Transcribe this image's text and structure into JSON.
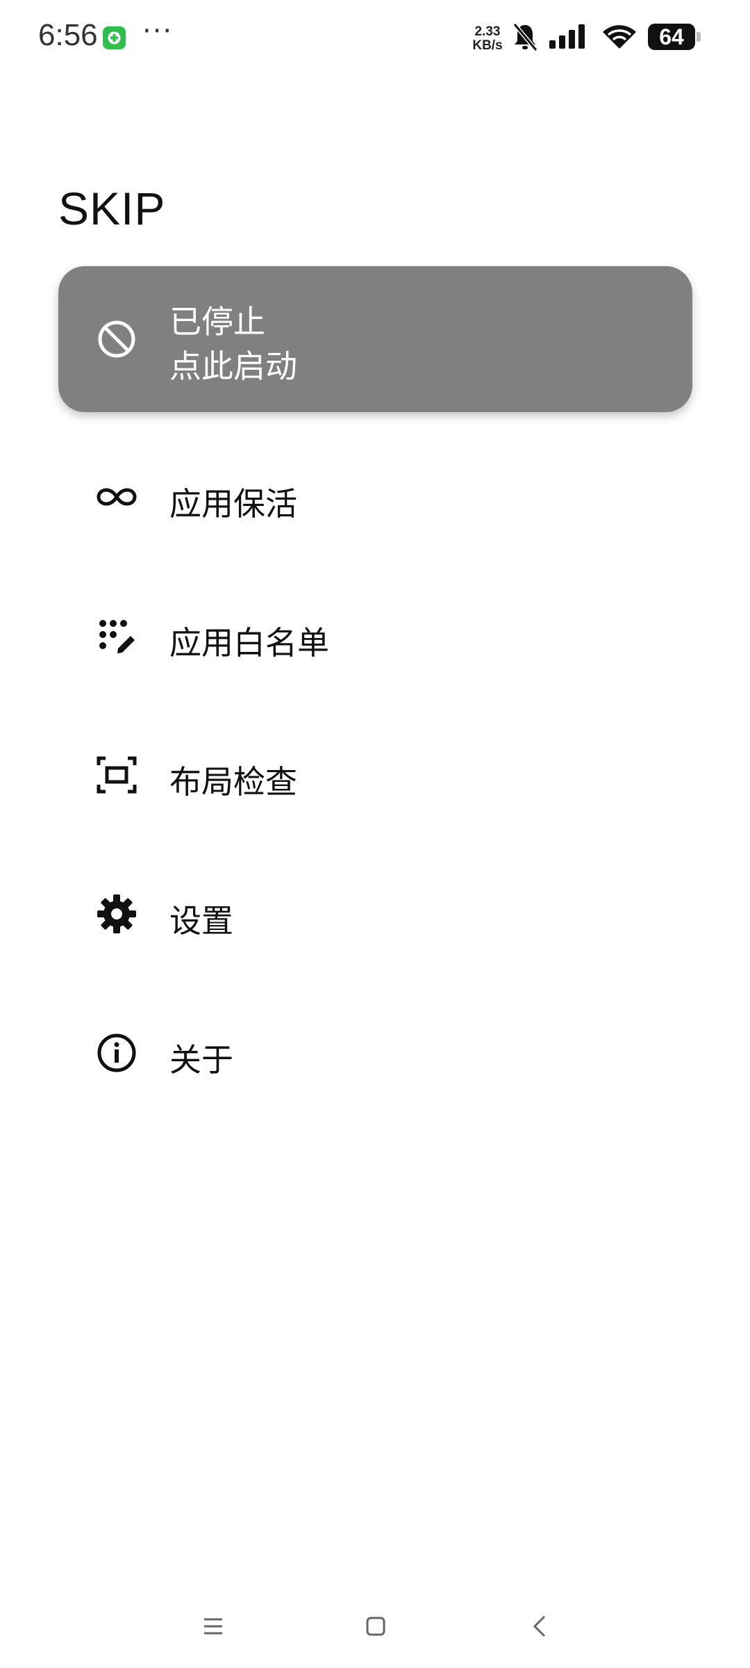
{
  "status_bar": {
    "time": "6:56",
    "more": "···",
    "net_speed_value": "2.33",
    "net_speed_unit": "KB/s",
    "battery": "64",
    "icons": [
      "app-notification-icon",
      "mute-bell-icon",
      "signal-icon",
      "wifi-icon",
      "battery-icon"
    ]
  },
  "header": {
    "title": "SKIP"
  },
  "status_card": {
    "line1": "已停止",
    "line2": "点此启动",
    "icon": "block-icon",
    "background": "#808080"
  },
  "menu": {
    "items": [
      {
        "label": "应用保活",
        "icon": "infinity-icon"
      },
      {
        "label": "应用白名单",
        "icon": "dots-edit-icon"
      },
      {
        "label": "布局检查",
        "icon": "screen-capture-icon"
      },
      {
        "label": "设置",
        "icon": "gear-icon"
      },
      {
        "label": "关于",
        "icon": "info-icon"
      }
    ]
  },
  "nav_bar": {
    "icons": [
      "menu-icon",
      "home-icon",
      "back-icon"
    ]
  }
}
